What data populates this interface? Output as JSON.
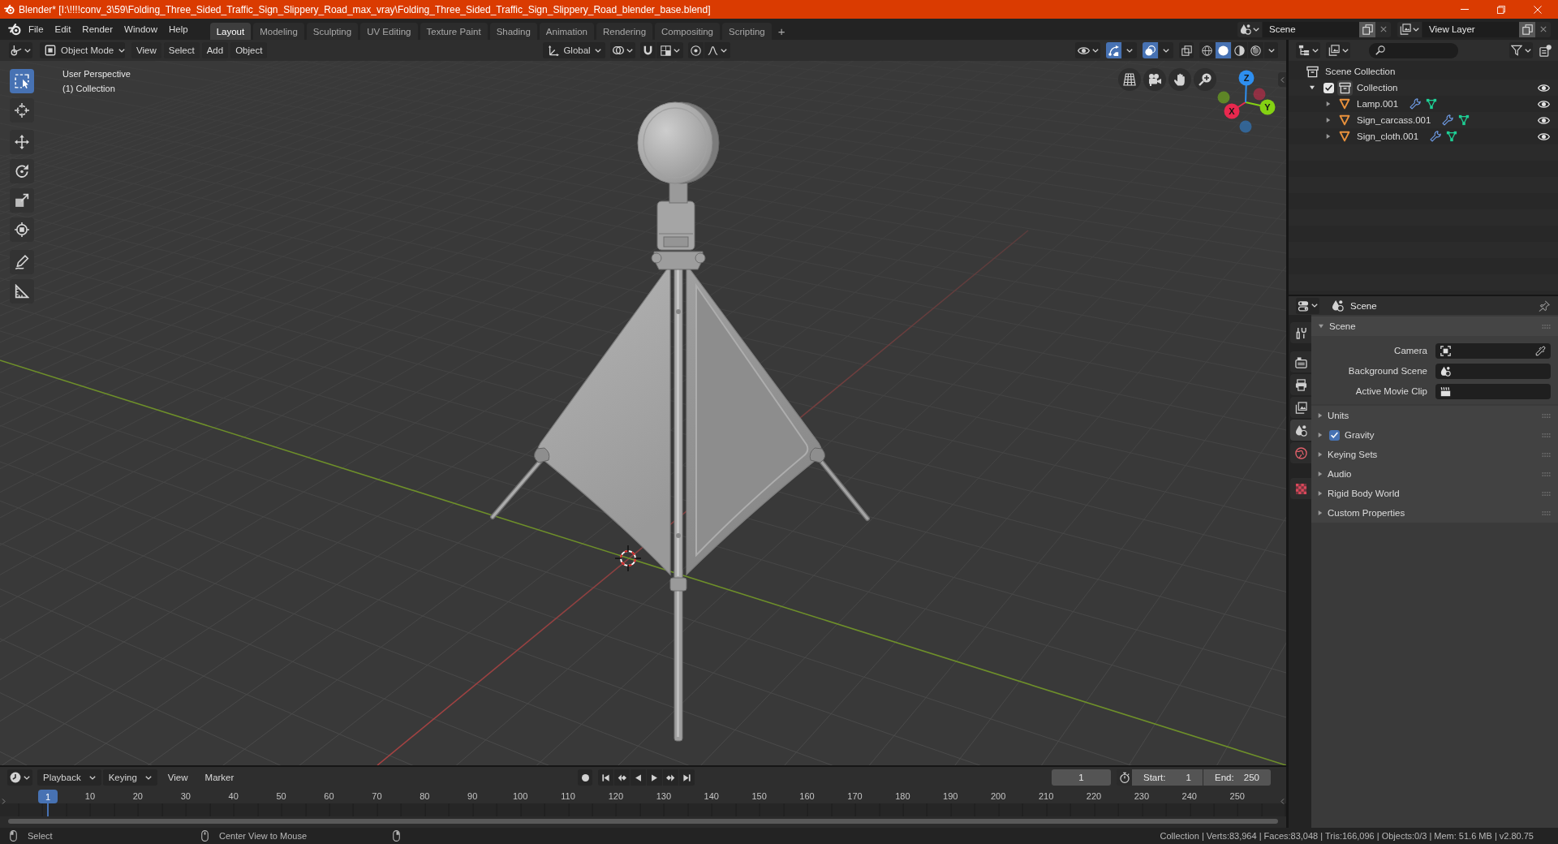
{
  "window": {
    "title": "Blender* [I:\\!!!!conv_3\\59\\Folding_Three_Sided_Traffic_Sign_Slippery_Road_max_vray\\Folding_Three_Sided_Traffic_Sign_Slippery_Road_blender_base.blend]"
  },
  "menu": [
    "File",
    "Edit",
    "Render",
    "Window",
    "Help"
  ],
  "workspaces": [
    {
      "label": "Layout",
      "selected": true
    },
    {
      "label": "Modeling",
      "selected": false
    },
    {
      "label": "Sculpting",
      "selected": false
    },
    {
      "label": "UV Editing",
      "selected": false
    },
    {
      "label": "Texture Paint",
      "selected": false
    },
    {
      "label": "Shading",
      "selected": false
    },
    {
      "label": "Animation",
      "selected": false
    },
    {
      "label": "Rendering",
      "selected": false
    },
    {
      "label": "Compositing",
      "selected": false
    },
    {
      "label": "Scripting",
      "selected": false
    }
  ],
  "add_workspace": "+",
  "scene": {
    "value": "Scene"
  },
  "view_layer": {
    "value": "View Layer"
  },
  "viewport": {
    "mode": "Object Mode",
    "menus": [
      "View",
      "Select",
      "Add",
      "Object"
    ],
    "orientation": "Global",
    "snap": {
      "on": false
    },
    "proportional_editing": {
      "on": false
    },
    "gizmos": {
      "on": true
    },
    "overlays": {
      "on": true
    },
    "xray": {
      "on": false
    },
    "shading": [
      {
        "kind": "wireframe",
        "selected": false
      },
      {
        "kind": "solid",
        "selected": true
      },
      {
        "kind": "material",
        "selected": false
      },
      {
        "kind": "rendered",
        "selected": false
      }
    ],
    "tools": [
      {
        "kind": "select_box",
        "selected": true
      },
      {
        "kind": "cursor",
        "selected": false
      },
      {
        "kind": "move",
        "selected": false
      },
      {
        "kind": "rotate",
        "selected": false
      },
      {
        "kind": "scale",
        "selected": false
      },
      {
        "kind": "transform",
        "selected": false
      },
      {
        "kind": "annotate",
        "selected": false
      },
      {
        "kind": "measure",
        "selected": false
      }
    ],
    "info": [
      "User Perspective",
      "(1) Collection"
    ],
    "axes": [
      {
        "label": "X",
        "color": "#e8284e"
      },
      {
        "label": "Y",
        "color": "#84d113"
      },
      {
        "label": "Z",
        "color": "#2e8ff0"
      }
    ]
  },
  "outliner": {
    "tree": [
      {
        "name": "Scene Collection",
        "kind": "scene_collection",
        "children": [
          {
            "name": "Collection",
            "kind": "collection",
            "checked": true,
            "expanded": true,
            "visible": true,
            "children": [
              {
                "name": "Lamp.001",
                "kind": "mesh",
                "expanded": false,
                "visible": true
              },
              {
                "name": "Sign_carcass.001",
                "kind": "mesh",
                "expanded": false,
                "visible": true
              },
              {
                "name": "Sign_cloth.001",
                "kind": "mesh",
                "expanded": false,
                "visible": true
              }
            ]
          }
        ]
      }
    ]
  },
  "properties": {
    "context": "Scene",
    "tabs": [
      {
        "kind": "tool",
        "selected": false
      },
      {
        "kind": "render",
        "selected": false
      },
      {
        "kind": "output",
        "selected": false
      },
      {
        "kind": "view_layer",
        "selected": false
      },
      {
        "kind": "scene",
        "selected": true
      },
      {
        "kind": "world",
        "selected": false
      },
      {
        "kind": "texture",
        "selected": false
      }
    ],
    "panels": [
      {
        "title": "Scene",
        "kind": "panel",
        "expanded": true,
        "fields": [
          {
            "label": "Camera",
            "kind": "camera"
          },
          {
            "label": "Background Scene",
            "kind": "scene"
          },
          {
            "label": "Active Movie Clip",
            "kind": "clip"
          }
        ]
      },
      {
        "title": "Units",
        "kind": "panel",
        "expanded": false
      },
      {
        "title": "Gravity",
        "kind": "toggle",
        "checked": true,
        "expanded": false
      },
      {
        "title": "Keying Sets",
        "kind": "panel",
        "expanded": false
      },
      {
        "title": "Audio",
        "kind": "panel",
        "expanded": false
      },
      {
        "title": "Rigid Body World",
        "kind": "panel",
        "expanded": false
      },
      {
        "title": "Custom Properties",
        "kind": "panel",
        "expanded": false
      }
    ]
  },
  "timeline": {
    "menus": [
      {
        "label": "Playback",
        "kind": "dropdown"
      },
      {
        "label": "Keying",
        "kind": "dropdown"
      },
      {
        "label": "View",
        "kind": "menu"
      },
      {
        "label": "Marker",
        "kind": "menu"
      }
    ],
    "current_frame": "1",
    "start": {
      "label": "Start:",
      "value": "1"
    },
    "end": {
      "label": "End:",
      "value": "250"
    },
    "playhead": "1",
    "ruler": [
      "10",
      "20",
      "30",
      "40",
      "50",
      "60",
      "70",
      "80",
      "90",
      "100",
      "110",
      "120",
      "130",
      "140",
      "150",
      "160",
      "170",
      "180",
      "190",
      "200",
      "210",
      "220",
      "230",
      "240",
      "250"
    ]
  },
  "status_bar": {
    "hints": [
      {
        "kind": "left",
        "label": "Select"
      },
      {
        "kind": "middle",
        "label": "Center View to Mouse"
      },
      {
        "kind": "right"
      }
    ],
    "stats": "Collection | Verts:83,964 | Faces:83,048 | Tris:166,096 | Objects:0/3 | Mem: 51.6 MB | v2.80.75"
  }
}
